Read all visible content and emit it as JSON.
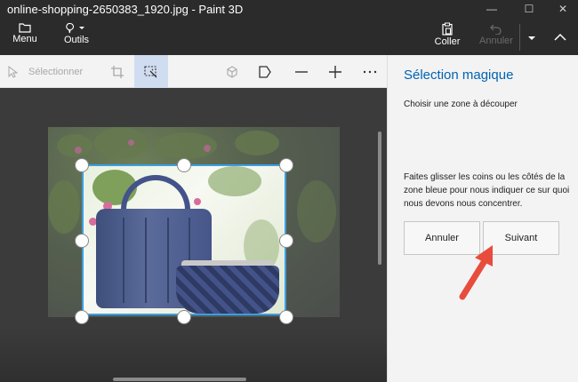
{
  "window": {
    "title": "online-shopping-2650383_1920.jpg - Paint 3D",
    "minimize_glyph": "—",
    "maximize_glyph": "☐",
    "close_glyph": "✕"
  },
  "ribbon": {
    "menu_label": "Menu",
    "tools_label": "Outils",
    "paste_label": "Coller",
    "undo_label": "Annuler"
  },
  "toolbar": {
    "select_label": "Sélectionner",
    "icons": [
      "select-pointer-icon",
      "crop-icon",
      "magic-select-icon",
      "3d-shapes-icon",
      "flag-shape-icon",
      "minus-icon",
      "plus-icon",
      "more-icon"
    ]
  },
  "panel": {
    "title": "Sélection magique",
    "subtitle": "Choisir une zone à découper",
    "description": "Faites glisser les coins ou les côtés de la zone bleue pour nous indiquer ce sur quoi nous devons nous concentrer.",
    "cancel_label": "Annuler",
    "next_label": "Suivant"
  },
  "colors": {
    "accent": "#0063b1",
    "selection_border": "#3a9ee6",
    "annotation_arrow": "#e84c3d",
    "active_tool": "#d0dcf0"
  }
}
